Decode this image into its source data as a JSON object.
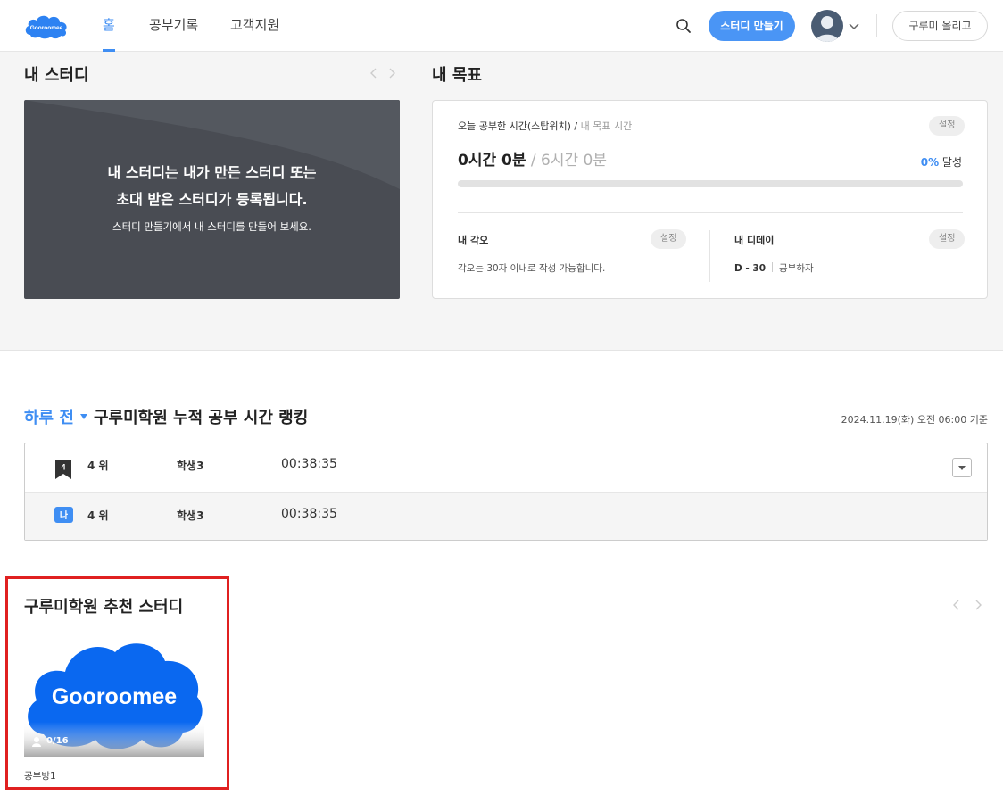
{
  "header": {
    "logo_text": "Gooroomee",
    "nav": [
      "홈",
      "공부기록",
      "고객지원"
    ],
    "create_button": "스터디 만들기",
    "upload_button": "구루미 올리고"
  },
  "my_study": {
    "title": "내 스터디",
    "banner_line1": "내 스터디는 내가 만든 스터디 또는",
    "banner_line2": "초대 받은 스터디가 등록됩니다.",
    "banner_line3": "스터디 만들기에서 내 스터디를 만들어 보세요."
  },
  "my_goal": {
    "title": "내 목표",
    "label_main": "오늘 공부한 시간(스탑워치) /",
    "label_muted": " 내 목표 시간",
    "settings": "설정",
    "studied": "0시간 0분",
    "target": " / 6시간 0분",
    "percent": "0%",
    "percent_suffix": " 달성",
    "progress": 0,
    "resolution_title": "내 각오",
    "resolution_text": "각오는 30자 이내로 작성 가능합니다.",
    "dday_title": "내 디데이",
    "dday_value": "D - 30",
    "dday_label": "공부하자"
  },
  "ranking": {
    "period": "하루 전",
    "title": "구루미학원 누적 공부 시간 랭킹",
    "as_of": "2024.11.19(화) 오전 06:00 기준",
    "rows": [
      {
        "badge": "4",
        "rank": "4 위",
        "name": "학생3",
        "time": "00:38:35"
      },
      {
        "badge": "나",
        "rank": "4 위",
        "name": "학생3",
        "time": "00:38:35"
      }
    ]
  },
  "recommended": {
    "title": "구루미학원 추천 스터디",
    "items": [
      {
        "logo_text": "Gooroomee",
        "count": "0/16",
        "name": "공부방1"
      }
    ]
  },
  "colors": {
    "accent": "#3f8ef3",
    "brand_blue": "#0a68f0",
    "highlight_red": "#e02020"
  }
}
